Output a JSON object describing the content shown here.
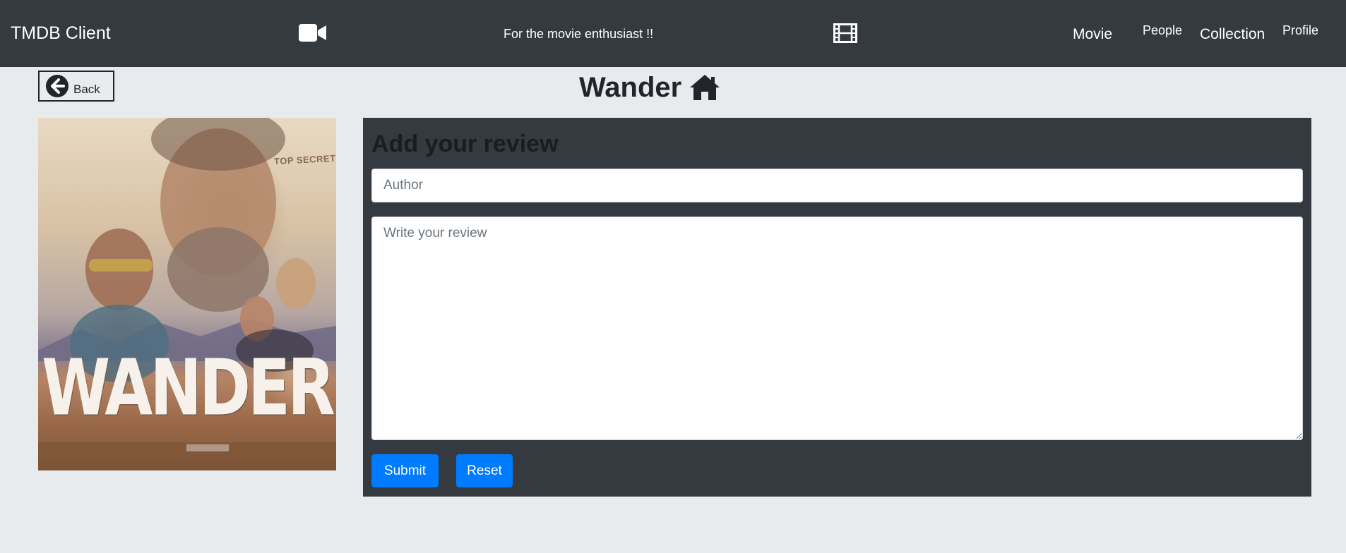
{
  "navbar": {
    "brand": "TMDB Client",
    "tagline": "For the movie enthusiast !!",
    "left_icon": "video-camera-icon",
    "right_icon": "film-icon",
    "links": {
      "movie": "Movie",
      "people": "People",
      "collection": "Collection",
      "profile": "Profile"
    }
  },
  "header": {
    "back_label": "Back",
    "back_icon": "arrow-circle-left-icon",
    "title": "Wander",
    "title_icon": "home-icon"
  },
  "poster": {
    "title_text": "WANDER",
    "stamp_text": "TOP SECRET"
  },
  "review": {
    "heading": "Add your review",
    "author_placeholder": "Author",
    "author_value": "",
    "review_placeholder": "Write your review",
    "review_value": "",
    "submit_label": "Submit",
    "reset_label": "Reset"
  },
  "colors": {
    "navbar_bg": "#343a40",
    "page_bg": "#e8ebee",
    "panel_bg": "#343a40",
    "primary_button": "#007bff"
  }
}
